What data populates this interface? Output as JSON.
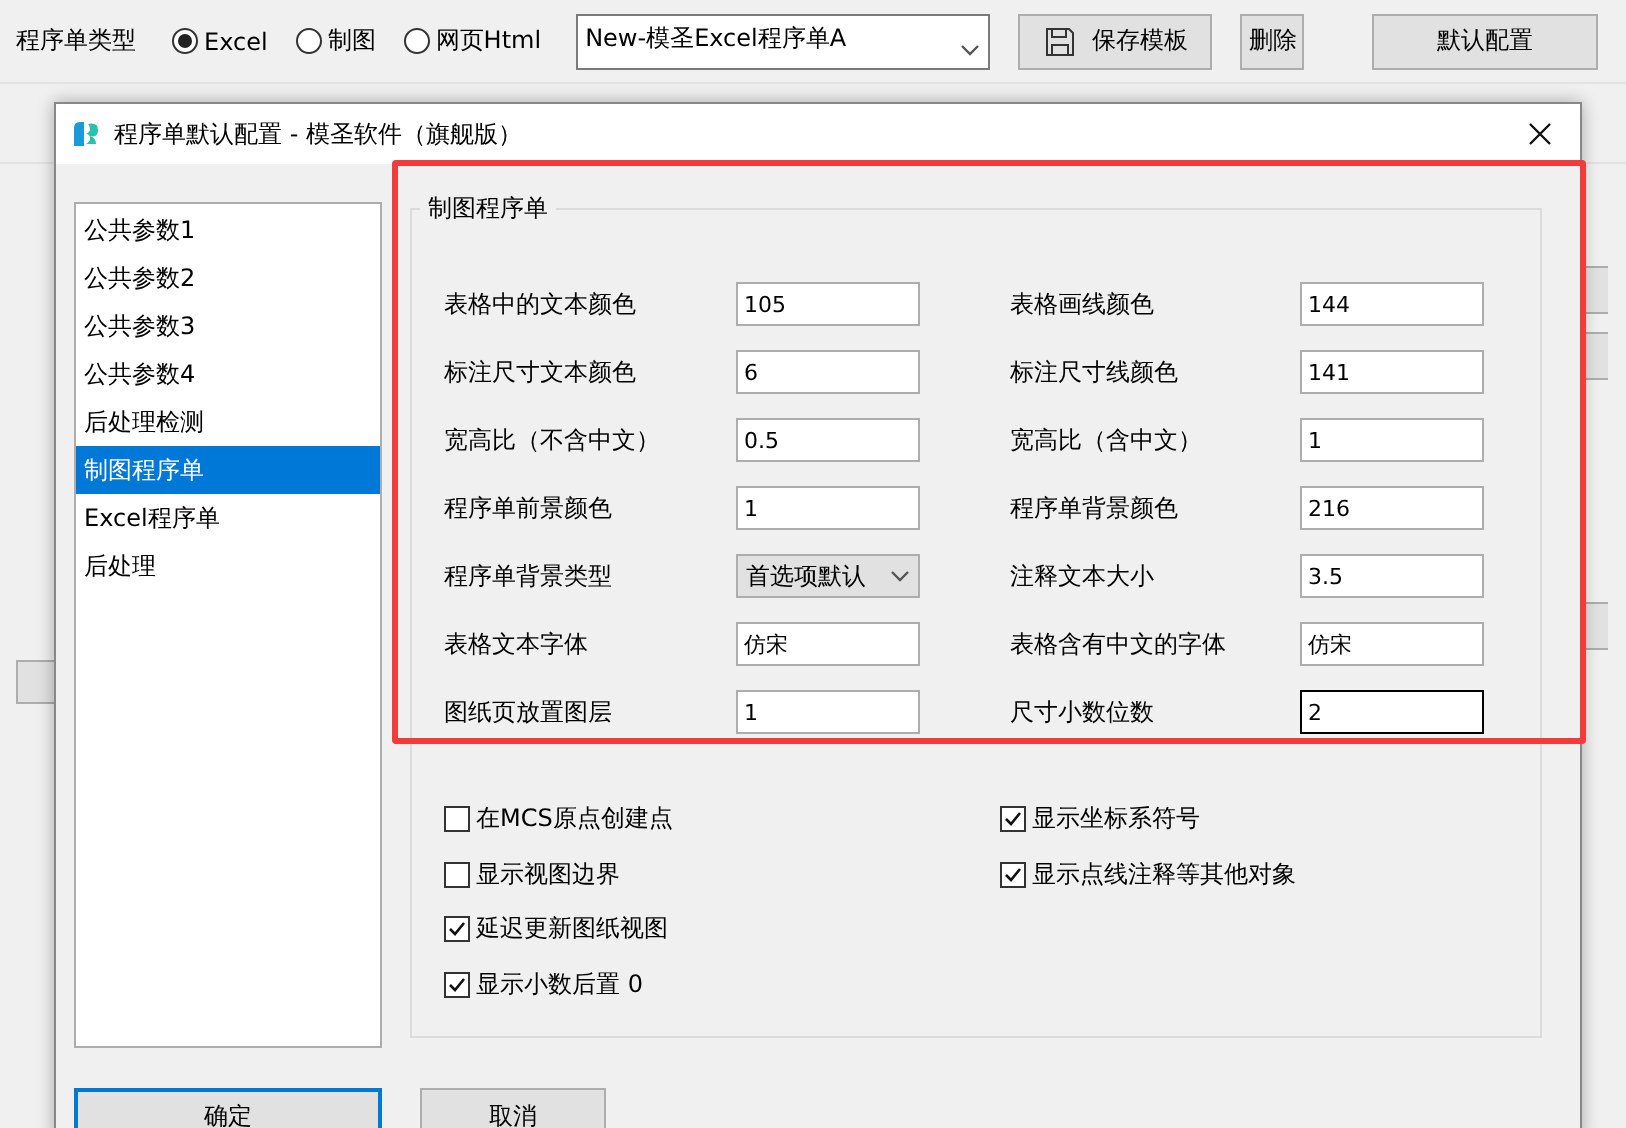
{
  "toolbar": {
    "label": "程序单类型",
    "radios": [
      {
        "label": "Excel",
        "selected": true
      },
      {
        "label": "制图",
        "selected": false
      },
      {
        "label": "网页Html",
        "selected": false
      }
    ],
    "template": {
      "value": "New-模圣Excel程序单A"
    },
    "buttons": [
      {
        "label": "保存模板",
        "kind": "save"
      },
      {
        "label": "删除",
        "kind": "plain"
      },
      {
        "label": "默认配置",
        "kind": "wide"
      }
    ]
  },
  "dialog": {
    "title": "程序单默认配置 - 模圣软件（旗舰版）",
    "sidebar": {
      "items": [
        {
          "label": "公共参数1",
          "selected": false
        },
        {
          "label": "公共参数2",
          "selected": false
        },
        {
          "label": "公共参数3",
          "selected": false
        },
        {
          "label": "公共参数4",
          "selected": false
        },
        {
          "label": "后处理检测",
          "selected": false
        },
        {
          "label": "制图程序单",
          "selected": true
        },
        {
          "label": "Excel程序单",
          "selected": false
        },
        {
          "label": "后处理",
          "selected": false
        }
      ]
    },
    "group": {
      "title": "制图程序单",
      "fields": [
        {
          "label": "表格中的文本颜色",
          "value": "105",
          "kind": "text",
          "focused": false
        },
        {
          "label": "表格画线颜色",
          "value": "144",
          "kind": "text",
          "focused": false
        },
        {
          "label": "标注尺寸文本颜色",
          "value": "6",
          "kind": "text",
          "focused": false
        },
        {
          "label": "标注尺寸线颜色",
          "value": "141",
          "kind": "text",
          "focused": false
        },
        {
          "label": "宽高比（不含中文）",
          "value": "0.5",
          "kind": "text",
          "focused": false
        },
        {
          "label": "宽高比（含中文）",
          "value": "1",
          "kind": "text",
          "focused": false
        },
        {
          "label": "程序单前景颜色",
          "value": "1",
          "kind": "text",
          "focused": false
        },
        {
          "label": "程序单背景颜色",
          "value": "216",
          "kind": "text",
          "focused": false
        },
        {
          "label": "程序单背景类型",
          "value": "首选项默认",
          "kind": "select"
        },
        {
          "label": "注释文本大小",
          "value": "3.5",
          "kind": "text",
          "focused": false
        },
        {
          "label": "表格文本字体",
          "value": "仿宋",
          "kind": "text",
          "focused": false
        },
        {
          "label": "表格含有中文的字体",
          "value": "仿宋",
          "kind": "text",
          "focused": false
        },
        {
          "label": "图纸页放置图层",
          "value": "1",
          "kind": "text",
          "focused": false
        },
        {
          "label": "尺寸小数位数",
          "value": "2",
          "kind": "text",
          "focused": true
        }
      ],
      "checkbox_columns": [
        [
          {
            "label": "在MCS原点创建点",
            "checked": false
          },
          {
            "label": "显示视图边界",
            "checked": false
          },
          {
            "label": "延迟更新图纸视图",
            "checked": true
          },
          {
            "label": "显示小数后置 0",
            "checked": true
          }
        ],
        [
          {
            "label": "显示坐标系符号",
            "checked": true
          },
          {
            "label": "显示点线注释等其他对象",
            "checked": true
          }
        ]
      ]
    },
    "buttons": [
      {
        "label": "确定",
        "default": true
      },
      {
        "label": "取消",
        "default": false
      }
    ]
  }
}
